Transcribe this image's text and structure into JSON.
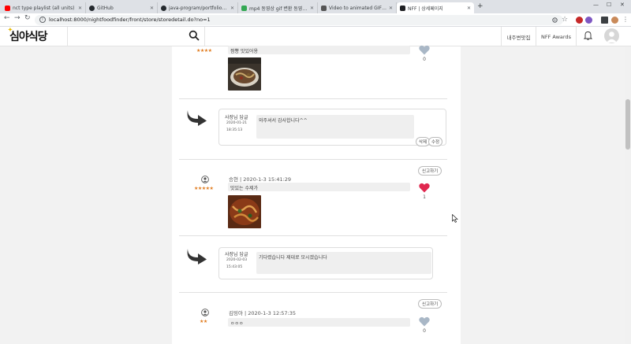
{
  "browser": {
    "tabs": [
      {
        "title": "nct type playlist (all units)",
        "favicon_color": "#ff0000"
      },
      {
        "title": "GitHub",
        "favicon_color": "#24292e"
      },
      {
        "title": "java-program/portfolio_image",
        "favicon_color": "#24292e"
      },
      {
        "title": "mp4 동영상 gif 변환 동영 만들",
        "favicon_color": "#34a853"
      },
      {
        "title": "Video to animated GIF converter",
        "favicon_color": "#555555"
      },
      {
        "title": "NFF | 상세페이지",
        "favicon_color": "#202124"
      }
    ],
    "url": "localhost:8000/nightfoodfinder/front/store/storedetail.do?no=1"
  },
  "site": {
    "logo": "심야식당",
    "nav": [
      "내주변맛집",
      "NFF Awards"
    ]
  },
  "reviews": [
    {
      "stars": "★★★★",
      "text": "짬뽕 맛있어용",
      "likes": "0",
      "liked": false
    },
    {
      "author_date": "승현 | 2020-1-3 15:41:29",
      "report_label": "신고하기",
      "stars": "★★★★★",
      "text": "맛있는 수제가",
      "likes": "1",
      "liked": true
    },
    {
      "author_date": "김밍아 | 2020-1-3 12:57:35",
      "report_label": "신고하기",
      "stars": "★★",
      "text": "ㅇㅇㅇ",
      "likes": "0",
      "liked": false
    }
  ],
  "replies": [
    {
      "owner": "사장님 답글",
      "date": "2020-01-21",
      "time": "18:35:13",
      "text": "와주셔서 감사합니다^^",
      "delete_label": "삭제",
      "edit_label": "수정"
    },
    {
      "owner": "사장님 답글",
      "date": "2020-02-03",
      "time": "15:43:05",
      "text": "기다렸습니다 제대로 모시겠습니다"
    }
  ],
  "colors": {
    "star": "#e07a1c",
    "heart_on": "#e0284f",
    "heart_off": "#a9b7c6"
  }
}
